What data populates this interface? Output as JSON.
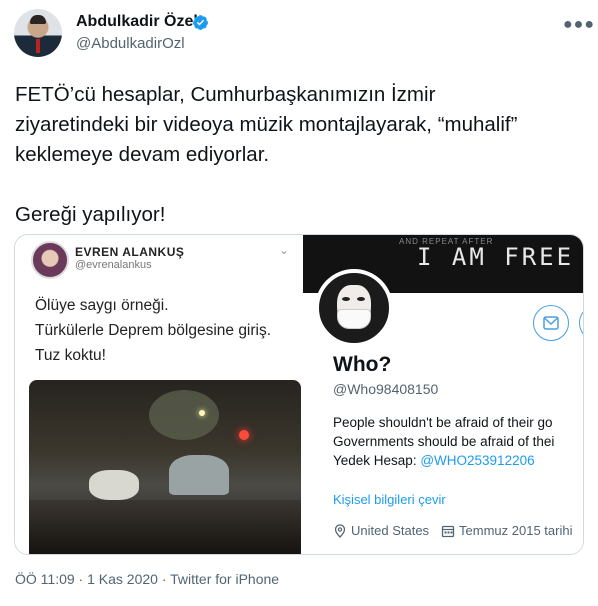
{
  "author": {
    "name": "Abdulkadir Özel",
    "handle": "@AbdulkadirOzl",
    "verified": true,
    "more_icon": "ellipsis-icon"
  },
  "tweet": {
    "line1": "FETÖ’cü hesaplar, Cumhurbaşkanımızın İzmir",
    "line2": "ziyaretindeki bir videoya müzik montajlayarak, “muhalif”",
    "line3": "keklemeye devam ediyorlar.",
    "line4": "Gereği yapılıyor!"
  },
  "embedded_tweet": {
    "name": "EVREN ALANKUŞ",
    "handle": "@evrenalankus",
    "text_line1": "Ölüye saygı örneği.",
    "text_line2": "Türkülerle Deprem bölgesine giriş.",
    "text_line3": "Tuz koktu!"
  },
  "profile": {
    "banner_small": "AND REPEAT AFTER",
    "banner_text": "I AM FREE",
    "name": "Who?",
    "handle": "@Who98408150",
    "bio_line1": "People shouldn't be afraid of their go",
    "bio_line2": "Governments should be afraid of thei",
    "bio_line3_prefix": "Yedek Hesap: ",
    "bio_link": "@WHO253912206",
    "translate": "Kişisel bilgileri çevir",
    "location": "United States",
    "joined": "Temmuz 2015 tarihi"
  },
  "footer": {
    "meta": "ÖÖ 11:09 · 1 Kas 2020 · Twitter for iPhone"
  },
  "colors": {
    "link": "#1d9bf0",
    "secondary_text": "#536471",
    "verified": "#1d9bf0"
  }
}
